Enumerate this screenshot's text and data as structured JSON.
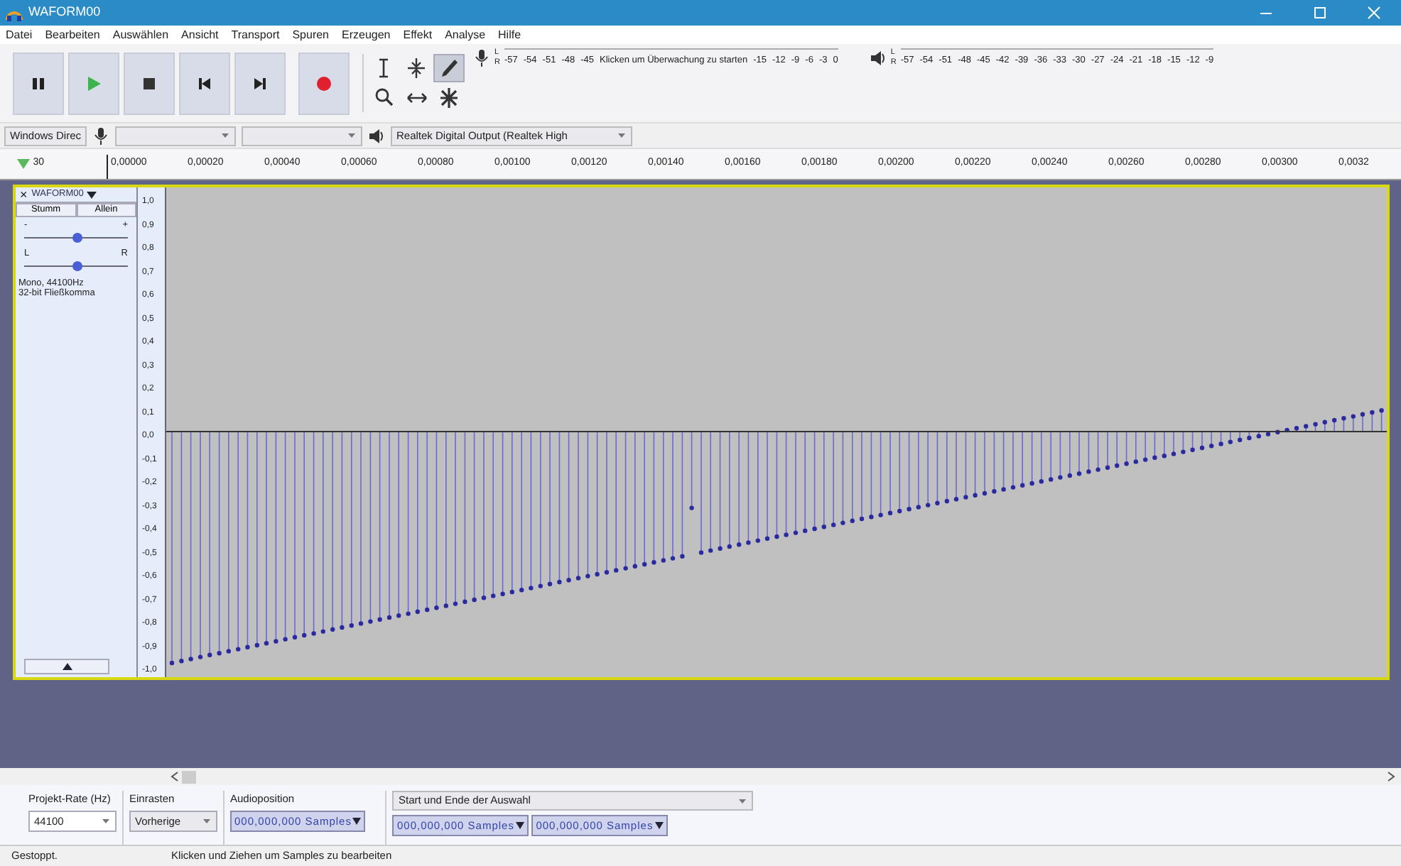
{
  "window": {
    "title": "WAFORM00"
  },
  "menu": [
    "Datei",
    "Bearbeiten",
    "Auswählen",
    "Ansicht",
    "Transport",
    "Spuren",
    "Erzeugen",
    "Effekt",
    "Analyse",
    "Hilfe"
  ],
  "transport": [
    {
      "kind": "pause"
    },
    {
      "kind": "play"
    },
    {
      "kind": "stop"
    },
    {
      "kind": "skip-start"
    },
    {
      "kind": "skip-end"
    },
    {
      "kind": "record"
    }
  ],
  "tools": [
    {
      "kind": "select",
      "selected": false
    },
    {
      "kind": "envelope",
      "selected": false
    },
    {
      "kind": "draw",
      "selected": true
    },
    {
      "kind": "zoom",
      "selected": false
    },
    {
      "kind": "timeshift",
      "selected": false
    },
    {
      "kind": "multi",
      "selected": false
    }
  ],
  "record_meter": {
    "channels": [
      "L",
      "R"
    ],
    "scale_start": [
      "-57",
      "-54",
      "-51",
      "-48",
      "-45"
    ],
    "hint": "Klicken um Überwachung zu starten",
    "scale_end": [
      "-15",
      "-12",
      "-9",
      "-6",
      "-3",
      "0"
    ]
  },
  "play_meter": {
    "channels": [
      "L",
      "R"
    ],
    "scale": [
      "-57",
      "-54",
      "-51",
      "-48",
      "-45",
      "-42",
      "-39",
      "-36",
      "-33",
      "-30",
      "-27",
      "-24",
      "-21",
      "-18",
      "-15",
      "-12",
      "-9"
    ]
  },
  "devices": {
    "host": "Windows Direc",
    "playback": "Realtek Digital Output (Realtek High"
  },
  "timeline": {
    "start_label": "30",
    "labels": [
      "0,00000",
      "0,00020",
      "0,00040",
      "0,00060",
      "0,00080",
      "0,00100",
      "0,00120",
      "0,00140",
      "0,00160",
      "0,00180",
      "0,00200",
      "0,00220",
      "0,00240",
      "0,00260",
      "0,00280",
      "0,00300",
      "0,0032"
    ]
  },
  "track": {
    "close": "×",
    "name": "WAFORM00",
    "buttons": [
      "Stumm",
      "Allein"
    ],
    "gain": {
      "min": "-",
      "max": "+",
      "level": 0.5
    },
    "pan": {
      "min": "L",
      "max": "R",
      "level": 0.5
    },
    "info": [
      "Mono, 44100Hz",
      "32-bit Fließkomma"
    ],
    "axis": [
      "1,0",
      "0,9",
      "0,8",
      "0,7",
      "0,6",
      "0,5",
      "0,4",
      "0,3",
      "0,2",
      "0,1",
      "0,0",
      "-0,1",
      "-0,2",
      "-0,3",
      "-0,4",
      "-0,5",
      "-0,6",
      "-0,7",
      "-0,8",
      "-0,9",
      "-1,0"
    ]
  },
  "selection_toolbar": {
    "rate_label": "Projekt-Rate (Hz)",
    "rate": "44100",
    "snap_label": "Einrasten",
    "snap": "Vorherige",
    "position_label": "Audioposition",
    "position": "000,000,000 Samples",
    "selection_label": "Start und Ende der Auswahl",
    "start": "000,000,000 Samples",
    "end": "000,000,000 Samples"
  },
  "status": {
    "state": "Gestoppt.",
    "hint": "Klicken und Ziehen um Samples zu bearbeiten"
  }
}
